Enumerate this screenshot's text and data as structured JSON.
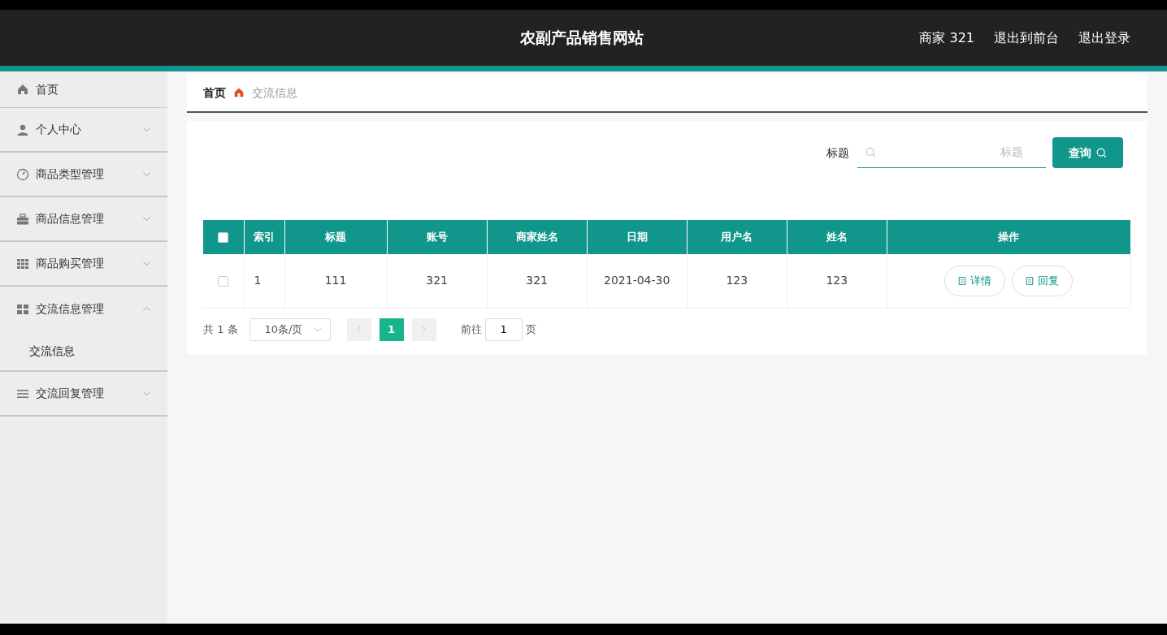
{
  "header": {
    "title": "农副产品销售网站",
    "links": [
      "商家 321",
      "退出到前台",
      "退出登录"
    ]
  },
  "sidebar": {
    "items": [
      {
        "label": "首页",
        "kind": "link"
      },
      {
        "label": "个人中心",
        "kind": "menu",
        "expanded": false
      },
      {
        "label": "商品类型管理",
        "kind": "menu",
        "expanded": false
      },
      {
        "label": "商品信息管理",
        "kind": "menu",
        "expanded": false
      },
      {
        "label": "商品购买管理",
        "kind": "menu",
        "expanded": false
      },
      {
        "label": "交流信息管理",
        "kind": "menu",
        "expanded": true,
        "children": [
          {
            "label": "交流信息"
          }
        ]
      },
      {
        "label": "交流回复管理",
        "kind": "menu",
        "expanded": false
      }
    ]
  },
  "breadcrumb": [
    "首页",
    "交流信息"
  ],
  "search": {
    "label": "标题",
    "placeholder": "标题",
    "button": "查询"
  },
  "table": {
    "header_checked": false,
    "columns": [
      "索引",
      "标题",
      "账号",
      "商家姓名",
      "日期",
      "用户名",
      "姓名",
      "操作"
    ],
    "rows": [
      {
        "checked": false,
        "cells": [
          "1",
          "111",
          "321",
          "321",
          "2021-04-30",
          "123",
          "123"
        ],
        "actions": [
          "详情",
          "回复"
        ]
      }
    ]
  },
  "pagination": {
    "total": "共 1 条",
    "page_size": "10条/页",
    "pages": [
      {
        "label": "1",
        "selected": true
      }
    ],
    "goto_label": "前往",
    "goto_value": "1",
    "goto_suffix": "页"
  }
}
